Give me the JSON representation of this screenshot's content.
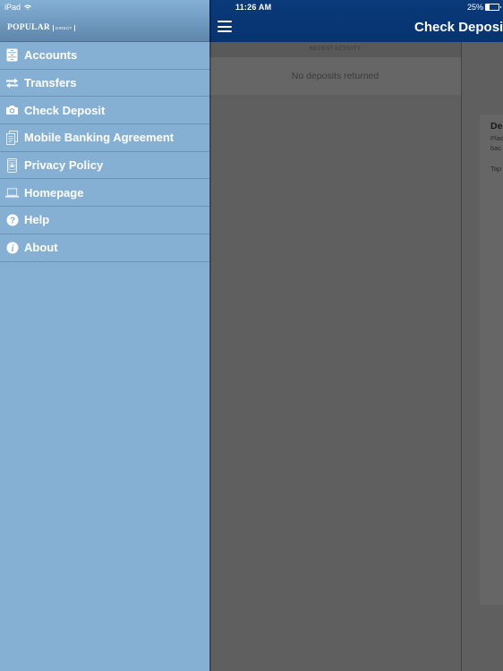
{
  "status_bar": {
    "device": "iPad",
    "time": "11:26 AM",
    "battery": "25%",
    "battery_level": 0.25
  },
  "sidebar": {
    "logo": {
      "main": "POPULAR",
      "sub": "DIRECT"
    },
    "items": [
      {
        "label": "Accounts",
        "icon": "accounts-icon"
      },
      {
        "label": "Transfers",
        "icon": "transfer-arrows-icon"
      },
      {
        "label": "Check Deposit",
        "icon": "camera-icon"
      },
      {
        "label": "Mobile Banking Agreement",
        "icon": "document-icon"
      },
      {
        "label": "Privacy Policy",
        "icon": "phone-lock-icon"
      },
      {
        "label": "Homepage",
        "icon": "laptop-icon"
      },
      {
        "label": "Help",
        "icon": "question-icon"
      },
      {
        "label": "About",
        "icon": "info-icon"
      }
    ]
  },
  "header": {
    "title": "Check Deposit"
  },
  "recent_activity": {
    "section_title": "RECENT ACTIVITY",
    "empty_message": "No deposits returned"
  },
  "detail_card": {
    "title": "De",
    "line1": "Plac",
    "line2": "bac",
    "line3": "Tap"
  },
  "colors": {
    "sidebar_bg": "#85b0d4",
    "header_bg": "#0a3a7a",
    "overlay_bg": "#5f5f5f"
  }
}
